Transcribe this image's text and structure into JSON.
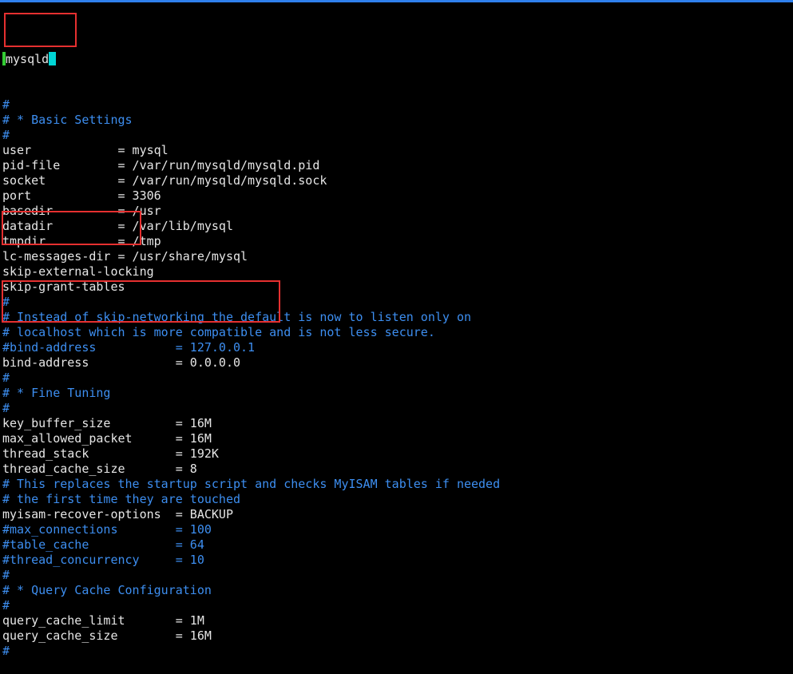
{
  "editor": {
    "header": "mysqld",
    "lines": [
      {
        "text": "#",
        "type": "comment"
      },
      {
        "text": "# * Basic Settings",
        "type": "comment"
      },
      {
        "text": "#",
        "type": "comment"
      },
      {
        "text": "user            = mysql",
        "type": "normal"
      },
      {
        "text": "pid-file        = /var/run/mysqld/mysqld.pid",
        "type": "normal"
      },
      {
        "text": "socket          = /var/run/mysqld/mysqld.sock",
        "type": "normal"
      },
      {
        "text": "port            = 3306",
        "type": "normal"
      },
      {
        "text": "basedir         = /usr",
        "type": "normal"
      },
      {
        "text": "datadir         = /var/lib/mysql",
        "type": "normal"
      },
      {
        "text": "tmpdir          = /tmp",
        "type": "normal"
      },
      {
        "text": "lc-messages-dir = /usr/share/mysql",
        "type": "normal"
      },
      {
        "text": "skip-external-locking",
        "type": "normal"
      },
      {
        "text": "skip-grant-tables",
        "type": "normal"
      },
      {
        "text": "#",
        "type": "comment"
      },
      {
        "text": "# Instead of skip-networking the default is now to listen only on",
        "type": "comment"
      },
      {
        "text": "# localhost which is more compatible and is not less secure.",
        "type": "comment"
      },
      {
        "text": "#bind-address           = 127.0.0.1",
        "type": "comment"
      },
      {
        "text": "bind-address            = 0.0.0.0",
        "type": "normal"
      },
      {
        "text": "#",
        "type": "comment"
      },
      {
        "text": "# * Fine Tuning",
        "type": "comment"
      },
      {
        "text": "#",
        "type": "comment"
      },
      {
        "text": "key_buffer_size         = 16M",
        "type": "normal"
      },
      {
        "text": "max_allowed_packet      = 16M",
        "type": "normal"
      },
      {
        "text": "thread_stack            = 192K",
        "type": "normal"
      },
      {
        "text": "thread_cache_size       = 8",
        "type": "normal"
      },
      {
        "text": "# This replaces the startup script and checks MyISAM tables if needed",
        "type": "comment"
      },
      {
        "text": "# the first time they are touched",
        "type": "comment"
      },
      {
        "text": "myisam-recover-options  = BACKUP",
        "type": "normal"
      },
      {
        "text": "#max_connections        = 100",
        "type": "comment"
      },
      {
        "text": "#table_cache            = 64",
        "type": "comment"
      },
      {
        "text": "#thread_concurrency     = 10",
        "type": "comment"
      },
      {
        "text": "#",
        "type": "comment"
      },
      {
        "text": "# * Query Cache Configuration",
        "type": "comment"
      },
      {
        "text": "#",
        "type": "comment"
      },
      {
        "text": "query_cache_limit       = 1M",
        "type": "normal"
      },
      {
        "text": "query_cache_size        = 16M",
        "type": "normal"
      },
      {
        "text": "#",
        "type": "comment"
      }
    ]
  },
  "colors": {
    "background": "#000000",
    "text": "#e6e6e6",
    "comment": "#3d8ef0",
    "highlight": "#e63030",
    "cursor_green": "#33cc33",
    "cursor_cyan": "#00d5d5",
    "top_bar": "#2f80ed"
  }
}
